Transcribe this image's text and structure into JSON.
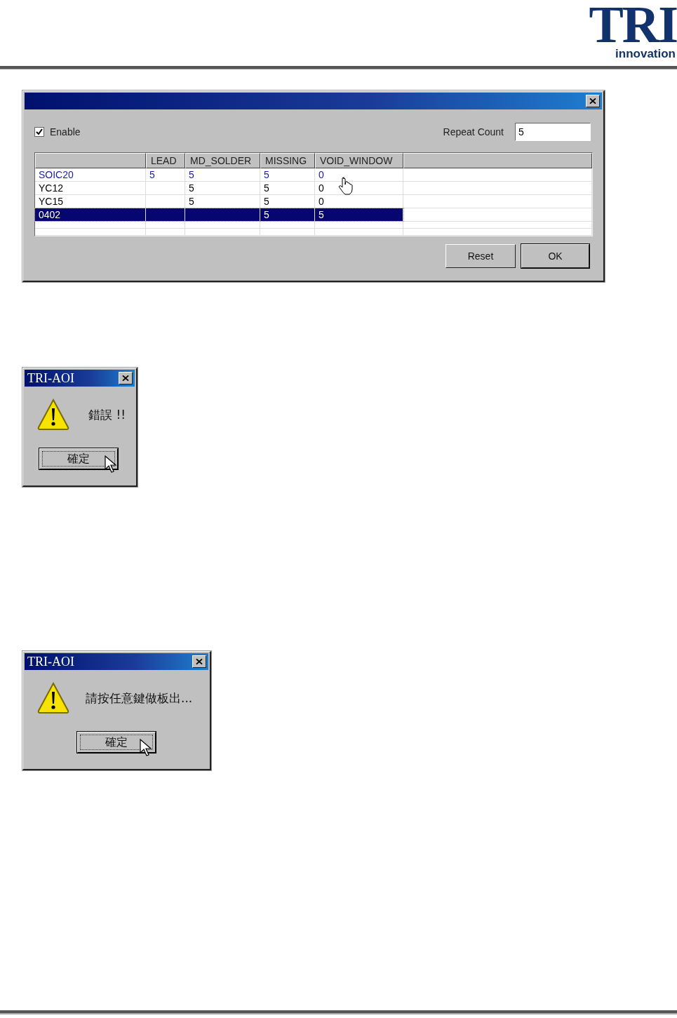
{
  "logo": {
    "mark": "TRI",
    "tagline": "innovation"
  },
  "settings_dialog": {
    "enable": {
      "label": "Enable",
      "checked": true
    },
    "repeat_count": {
      "label": "Repeat Count",
      "value": "5"
    },
    "table": {
      "columns": [
        "LEAD",
        "MD_SOLDER",
        "MISSING",
        "VOID_WINDOW"
      ],
      "rows": [
        {
          "name": "SOIC20",
          "lead": "5",
          "md_solder": "5",
          "missing": "5",
          "void_window": "0",
          "highlighted": true,
          "selected": false
        },
        {
          "name": "YC12",
          "md_solder": "5",
          "missing": "5",
          "void_window": "0",
          "highlighted": false,
          "selected": false
        },
        {
          "name": "YC15",
          "md_solder": "5",
          "missing": "5",
          "void_window": "0",
          "highlighted": false,
          "selected": false
        },
        {
          "name": "0402",
          "missing": "5",
          "void_window": "5",
          "highlighted": false,
          "selected": true
        }
      ]
    },
    "buttons": [
      "Reset",
      "OK"
    ]
  },
  "message_dialogs": [
    {
      "title": "TRI-AOI",
      "message": "錯誤 !!",
      "button": "確定"
    },
    {
      "title": "TRI-AOI",
      "message": "請按任意鍵做板出...",
      "button": "確定"
    }
  ]
}
